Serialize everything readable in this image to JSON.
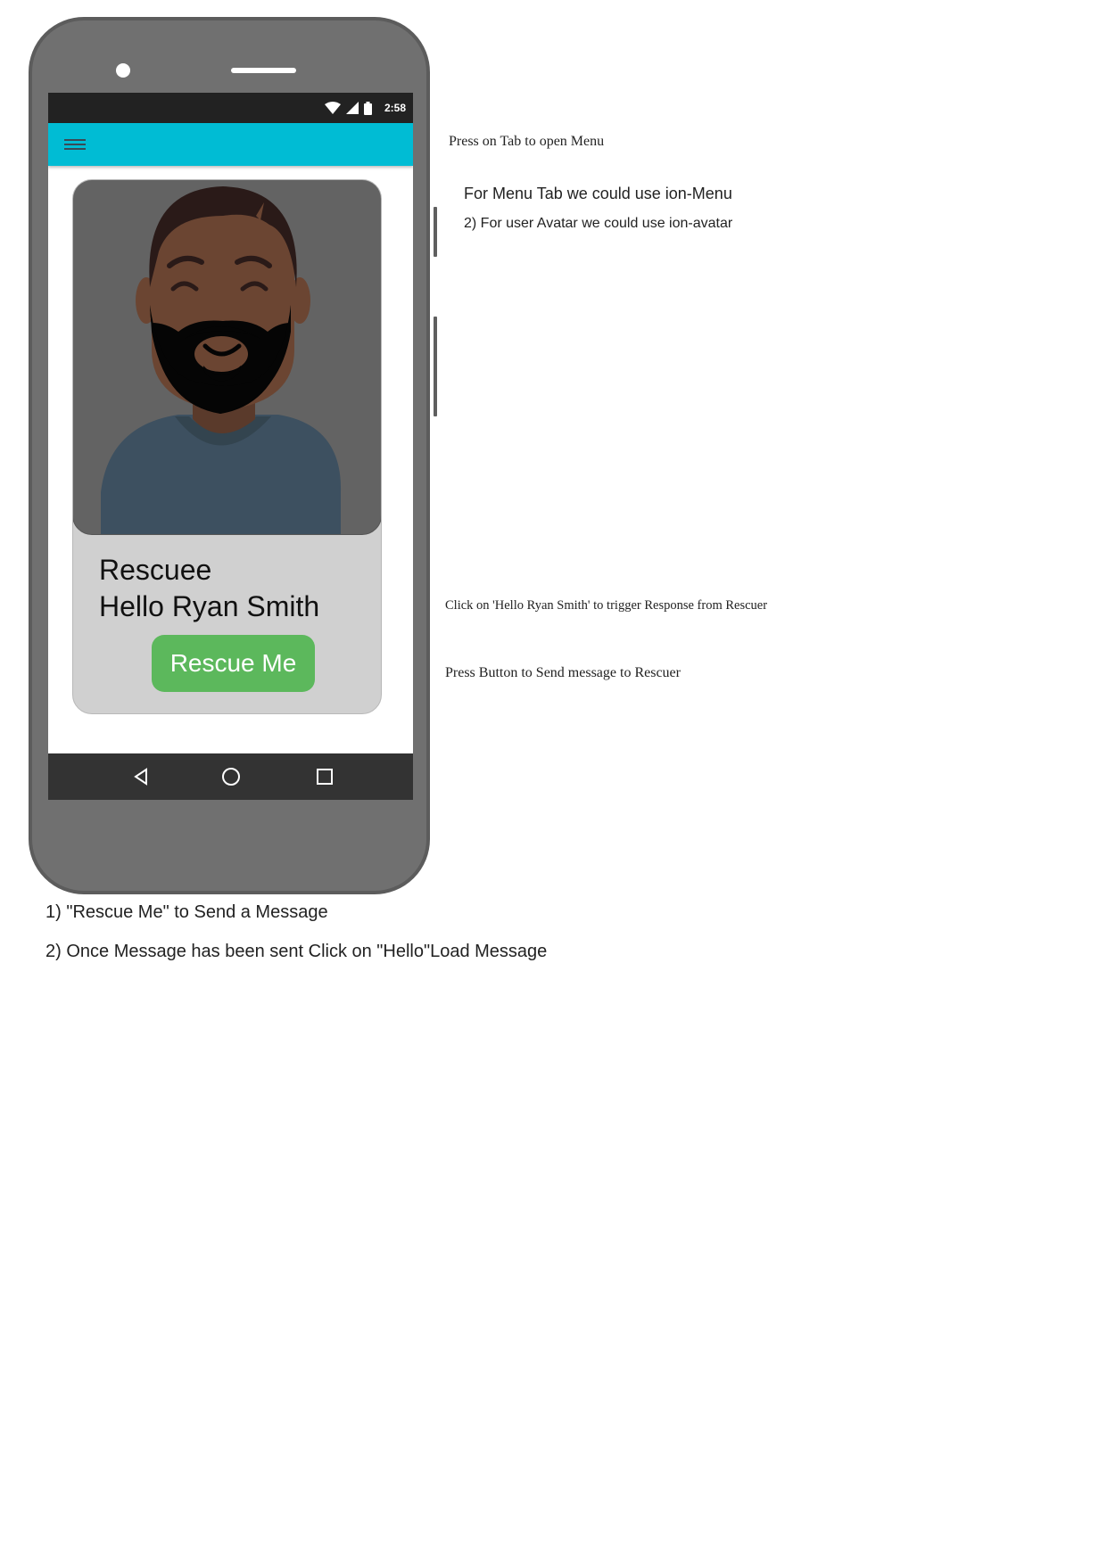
{
  "status_bar": {
    "time": "2:58",
    "icons": [
      "wifi-icon",
      "cell-signal-icon",
      "battery-icon"
    ]
  },
  "toolbar": {
    "menu_icon": "hamburger-menu-icon",
    "color": "#00bcd4"
  },
  "card": {
    "avatar": "user-avatar",
    "title": "Rescuee",
    "greeting": "Hello Ryan Smith",
    "button_label": "Rescue Me",
    "button_color": "#5cb85c"
  },
  "nav_bar": {
    "icons": [
      "back-icon",
      "home-icon",
      "recents-icon"
    ]
  },
  "annotations": {
    "menu_tab": "Press on Tab to open Menu",
    "ion_menu": "For Menu Tab we could use ion-Menu",
    "ion_avatar": "2) For user Avatar we could use ion-avatar",
    "hello_click": "Click on 'Hello Ryan Smith' to trigger Response from Rescuer",
    "press_button": "Press Button to Send message to Rescuer"
  },
  "instructions": {
    "step1": "1) \"Rescue Me\" to Send a Message",
    "step2": "2) Once Message has been sent Click on \"Hello\"Load Message"
  }
}
